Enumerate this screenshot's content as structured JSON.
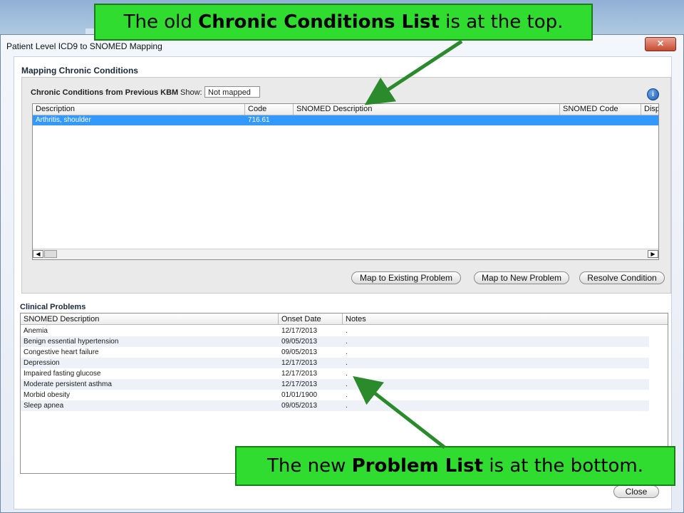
{
  "window": {
    "title": "Patient Level ICD9 to SNOMED Mapping",
    "close_label": "✕"
  },
  "main": {
    "heading": "Mapping Chronic Conditions"
  },
  "chronic": {
    "title": "Chronic Conditions from Previous KBM",
    "show_label": "Show:",
    "show_value": "Not mapped",
    "info_icon": "i",
    "columns": [
      "Description",
      "Code",
      "SNOMED Description",
      "SNOMED Code",
      "Disp"
    ],
    "rows": [
      {
        "description": "Arthritis, shoulder",
        "code": "716.61",
        "snomed_description": "",
        "snomed_code": ""
      }
    ],
    "scroll_left": "◀",
    "scroll_right": "▶"
  },
  "actions": {
    "map_existing": "Map to Existing Problem",
    "map_new": "Map to New Problem",
    "resolve": "Resolve Condition"
  },
  "problems": {
    "title": "Clinical Problems",
    "columns": [
      "SNOMED Description",
      "Onset Date",
      "Notes"
    ],
    "rows": [
      {
        "desc": "Anemia",
        "onset": "12/17/2013",
        "notes": "."
      },
      {
        "desc": "Benign essential hypertension",
        "onset": "09/05/2013",
        "notes": "."
      },
      {
        "desc": "Congestive heart failure",
        "onset": "09/05/2013",
        "notes": "."
      },
      {
        "desc": "Depression",
        "onset": "12/17/2013",
        "notes": "."
      },
      {
        "desc": "Impaired fasting glucose",
        "onset": "12/17/2013",
        "notes": "."
      },
      {
        "desc": "Moderate persistent asthma",
        "onset": "12/17/2013",
        "notes": "."
      },
      {
        "desc": "Morbid obesity",
        "onset": "01/01/1900",
        "notes": "."
      },
      {
        "desc": "Sleep apnea",
        "onset": "09/05/2013",
        "notes": "."
      }
    ]
  },
  "footer": {
    "close_label": "Close"
  },
  "callouts": {
    "top_pre": "The old ",
    "top_bold": "Chronic Conditions List",
    "top_post": " is at the top.",
    "bottom_pre": "The new ",
    "bottom_bold": "Problem List",
    "bottom_post": " is at the bottom."
  },
  "colors": {
    "callout_fill": "#2fdc2f",
    "selection": "#3399ff",
    "arrow": "#2b8a2b"
  }
}
